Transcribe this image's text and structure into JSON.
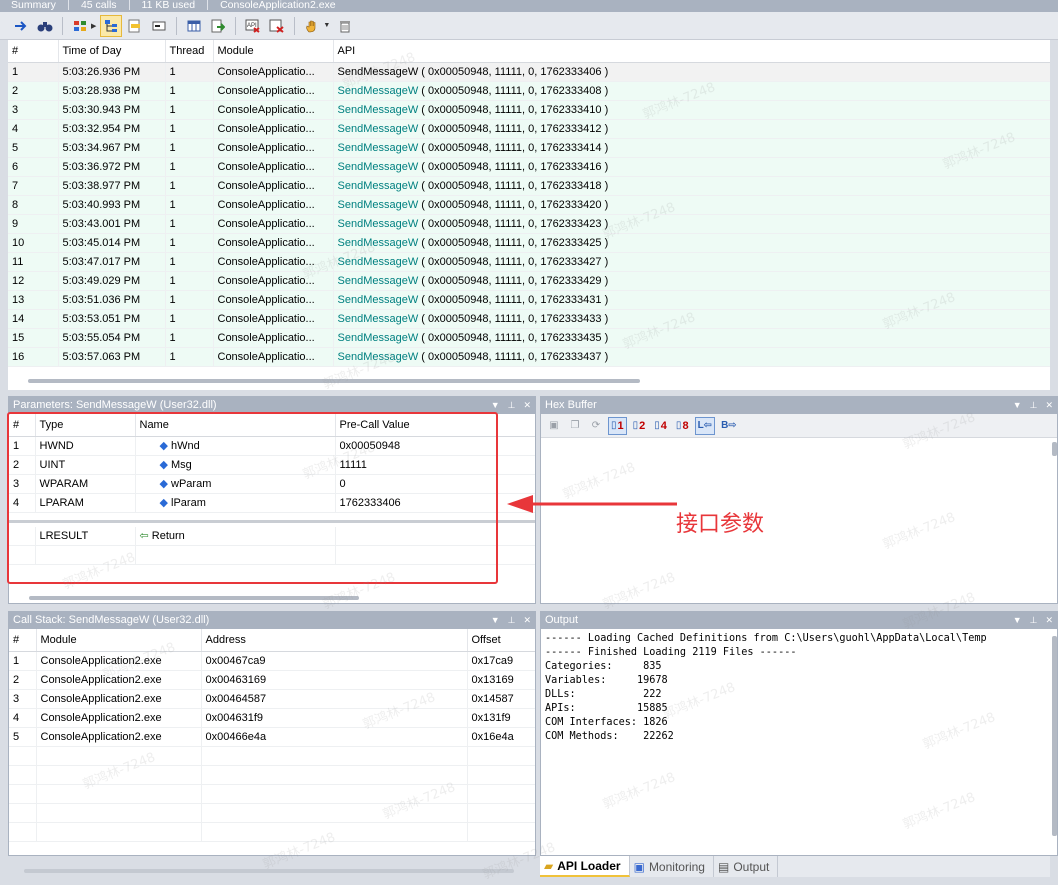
{
  "summary": {
    "label": "Summary",
    "calls": "45 calls",
    "memory": "11 KB used",
    "process": "ConsoleApplication2.exe"
  },
  "toolbar": {
    "icons": [
      "arrow-right-icon",
      "binoculars-icon",
      "grid-icon",
      "tree-view-icon",
      "highlight-icon",
      "memory-icon",
      "columns-icon",
      "export-icon",
      "api-filter-icon",
      "clear-filter-icon",
      "hand-icon",
      "trash-icon"
    ]
  },
  "api_list": {
    "columns": [
      "#",
      "Time of Day",
      "Thread",
      "Module",
      "API"
    ],
    "rows": [
      {
        "n": "1",
        "time": "5:03:26.936 PM",
        "thread": "1",
        "module": "ConsoleApplicatio...",
        "api": "SendMessageW",
        "args": " ( 0x00050948, 11111, 0, 1762333406 )"
      },
      {
        "n": "2",
        "time": "5:03:28.938 PM",
        "thread": "1",
        "module": "ConsoleApplicatio...",
        "api": "SendMessageW",
        "args": " ( 0x00050948, 11111, 0, 1762333408 )"
      },
      {
        "n": "3",
        "time": "5:03:30.943 PM",
        "thread": "1",
        "module": "ConsoleApplicatio...",
        "api": "SendMessageW",
        "args": " ( 0x00050948, 11111, 0, 1762333410 )"
      },
      {
        "n": "4",
        "time": "5:03:32.954 PM",
        "thread": "1",
        "module": "ConsoleApplicatio...",
        "api": "SendMessageW",
        "args": " ( 0x00050948, 11111, 0, 1762333412 )"
      },
      {
        "n": "5",
        "time": "5:03:34.967 PM",
        "thread": "1",
        "module": "ConsoleApplicatio...",
        "api": "SendMessageW",
        "args": " ( 0x00050948, 11111, 0, 1762333414 )"
      },
      {
        "n": "6",
        "time": "5:03:36.972 PM",
        "thread": "1",
        "module": "ConsoleApplicatio...",
        "api": "SendMessageW",
        "args": " ( 0x00050948, 11111, 0, 1762333416 )"
      },
      {
        "n": "7",
        "time": "5:03:38.977 PM",
        "thread": "1",
        "module": "ConsoleApplicatio...",
        "api": "SendMessageW",
        "args": " ( 0x00050948, 11111, 0, 1762333418 )"
      },
      {
        "n": "8",
        "time": "5:03:40.993 PM",
        "thread": "1",
        "module": "ConsoleApplicatio...",
        "api": "SendMessageW",
        "args": " ( 0x00050948, 11111, 0, 1762333420 )"
      },
      {
        "n": "9",
        "time": "5:03:43.001 PM",
        "thread": "1",
        "module": "ConsoleApplicatio...",
        "api": "SendMessageW",
        "args": " ( 0x00050948, 11111, 0, 1762333423 )"
      },
      {
        "n": "10",
        "time": "5:03:45.014 PM",
        "thread": "1",
        "module": "ConsoleApplicatio...",
        "api": "SendMessageW",
        "args": " ( 0x00050948, 11111, 0, 1762333425 )"
      },
      {
        "n": "11",
        "time": "5:03:47.017 PM",
        "thread": "1",
        "module": "ConsoleApplicatio...",
        "api": "SendMessageW",
        "args": " ( 0x00050948, 11111, 0, 1762333427 )"
      },
      {
        "n": "12",
        "time": "5:03:49.029 PM",
        "thread": "1",
        "module": "ConsoleApplicatio...",
        "api": "SendMessageW",
        "args": " ( 0x00050948, 11111, 0, 1762333429 )"
      },
      {
        "n": "13",
        "time": "5:03:51.036 PM",
        "thread": "1",
        "module": "ConsoleApplicatio...",
        "api": "SendMessageW",
        "args": " ( 0x00050948, 11111, 0, 1762333431 )"
      },
      {
        "n": "14",
        "time": "5:03:53.051 PM",
        "thread": "1",
        "module": "ConsoleApplicatio...",
        "api": "SendMessageW",
        "args": " ( 0x00050948, 11111, 0, 1762333433 )"
      },
      {
        "n": "15",
        "time": "5:03:55.054 PM",
        "thread": "1",
        "module": "ConsoleApplicatio...",
        "api": "SendMessageW",
        "args": " ( 0x00050948, 11111, 0, 1762333435 )"
      },
      {
        "n": "16",
        "time": "5:03:57.063 PM",
        "thread": "1",
        "module": "ConsoleApplicatio...",
        "api": "SendMessageW",
        "args": " ( 0x00050948, 11111, 0, 1762333437 )"
      }
    ]
  },
  "parameters": {
    "title": "Parameters: SendMessageW (User32.dll)",
    "columns": [
      "#",
      "Type",
      "Name",
      "Pre-Call Value"
    ],
    "rows": [
      {
        "n": "1",
        "type": "HWND",
        "name": "hWnd",
        "value": "0x00050948"
      },
      {
        "n": "2",
        "type": "UINT",
        "name": "Msg",
        "value": "11111"
      },
      {
        "n": "3",
        "type": "WPARAM",
        "name": "wParam",
        "value": "0"
      },
      {
        "n": "4",
        "type": "LPARAM",
        "name": "lParam",
        "value": "1762333406"
      }
    ],
    "return_type": "LRESULT",
    "return_name": "Return"
  },
  "hex_buffer": {
    "title": "Hex Buffer",
    "buttons": [
      "1",
      "2",
      "4",
      "8",
      "L",
      "B"
    ]
  },
  "call_stack": {
    "title": "Call Stack: SendMessageW (User32.dll)",
    "columns": [
      "#",
      "Module",
      "Address",
      "Offset"
    ],
    "rows": [
      {
        "n": "1",
        "module": "ConsoleApplication2.exe",
        "address": "0x00467ca9",
        "offset": "0x17ca9"
      },
      {
        "n": "2",
        "module": "ConsoleApplication2.exe",
        "address": "0x00463169",
        "offset": "0x13169"
      },
      {
        "n": "3",
        "module": "ConsoleApplication2.exe",
        "address": "0x00464587",
        "offset": "0x14587"
      },
      {
        "n": "4",
        "module": "ConsoleApplication2.exe",
        "address": "0x004631f9",
        "offset": "0x131f9"
      },
      {
        "n": "5",
        "module": "ConsoleApplication2.exe",
        "address": "0x00466e4a",
        "offset": "0x16e4a"
      }
    ]
  },
  "output": {
    "title": "Output",
    "lines": [
      "------ Loading Cached Definitions from C:\\Users\\guohl\\AppData\\Local\\Temp",
      "------ Finished Loading 2119 Files ------",
      "Categories:     835",
      "Variables:     19678",
      "DLLs:           222",
      "APIs:          15885",
      "COM Interfaces: 1826",
      "COM Methods:    22262"
    ]
  },
  "bottom_tabs": [
    {
      "label": "API Loader",
      "icon": "folder-icon",
      "active": true
    },
    {
      "label": "Monitoring",
      "icon": "monitor-icon",
      "active": false
    },
    {
      "label": "Output",
      "icon": "output-icon",
      "active": false
    }
  ],
  "annotation": {
    "label": "接口参数",
    "color": "#e8363a"
  },
  "watermark": "郭鸿林-7248"
}
